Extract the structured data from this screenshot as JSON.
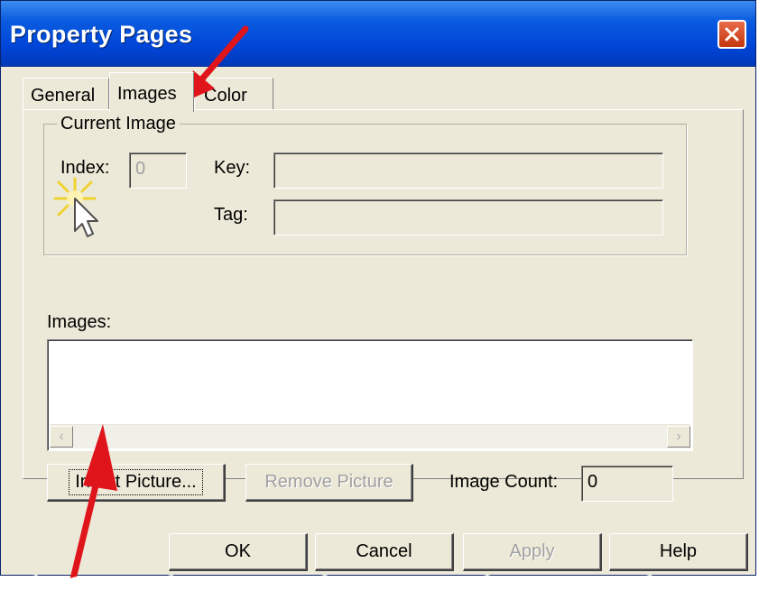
{
  "window": {
    "title": "Property Pages",
    "close_icon": "close-icon"
  },
  "tabs": [
    {
      "label": "General",
      "active": false
    },
    {
      "label": "Images",
      "active": true
    },
    {
      "label": "Color",
      "active": false
    }
  ],
  "current_image": {
    "legend": "Current Image",
    "index_label": "Index:",
    "index_value": "0",
    "key_label": "Key:",
    "key_value": "",
    "tag_label": "Tag:",
    "tag_value": ""
  },
  "images_list": {
    "label": "Images:",
    "items": []
  },
  "buttons": {
    "insert_picture": "Insert Picture...",
    "remove_picture": "Remove Picture",
    "ok": "OK",
    "cancel": "Cancel",
    "apply": "Apply",
    "help": "Help"
  },
  "image_count": {
    "label": "Image Count:",
    "value": "0"
  },
  "colors": {
    "annotation_arrow": "#e0151b",
    "title_bar": "#0054e3"
  }
}
